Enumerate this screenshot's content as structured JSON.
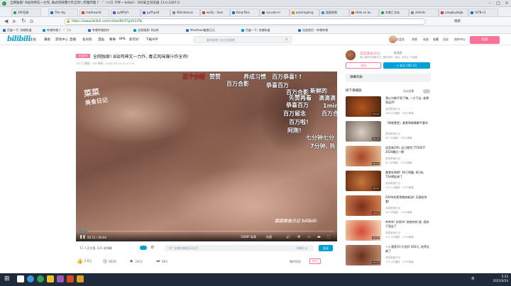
{
  "window": {
    "title": "全网独家! B站鸡神又一力作, 毒式风味爆汁炸全鸡!_哔哩哔哩 (゜-゜)つロ 干杯~-bilibili - 360安全浏览器 13.0.2287.0"
  },
  "tabs": [
    {
      "label": "360导航"
    },
    {
      "label": "The sky"
    },
    {
      "label": "mathworld"
    },
    {
      "label": "pyMPyfs"
    },
    {
      "label": "pyPhyalt"
    },
    {
      "label": "Wikidatavis"
    },
    {
      "label": "wolfy - Sam"
    },
    {
      "label": "Kmq-filos"
    },
    {
      "label": "via plan-Ir"
    },
    {
      "label": "piesimgiong"
    },
    {
      "label": "超星视频"
    },
    {
      "label": "Hide on bu"
    },
    {
      "label": "杂食汇总站"
    },
    {
      "label": "sitekits"
    },
    {
      "label": "yangkujialgb"
    },
    {
      "label": "YoTB+2"
    }
  ],
  "addressbar": {
    "url": "https://www.bilibili.com/video/BV1Tg4113Tw",
    "search_label": "搜索"
  },
  "bookmarks": [
    {
      "label": "百度一下, 你就知道"
    },
    {
      "label": "哔哩哔哩 (゜-゜)つ"
    },
    {
      "label": "哔哩哔哩创作"
    },
    {
      "label": "全网独家! B站鸡"
    },
    {
      "label": "Meetfood美食日记"
    },
    {
      "label": "百度一下, 你就知道"
    },
    {
      "label": "动态首页 - 哔哩哔哩"
    }
  ],
  "site_header": {
    "logo": "bilibili",
    "nav": [
      "主站",
      "番剧",
      "游戏中心",
      "直播",
      "会员购",
      "漫画",
      "赛事",
      "BML",
      "新年好",
      "下载APP"
    ],
    "search_placeholder": "春季美食少女社恩能哦",
    "user_nav": [
      "大会员",
      "消息",
      "动态",
      "收藏",
      "历史",
      "创作中心"
    ],
    "upload_label": "投稿"
  },
  "video": {
    "badge": "全站排行",
    "title": "全网独家! B站鸡神又一力作, 毒式风味爆汁炸全鸡!",
    "meta": "16.7万播放 · 520弹幕 · 2021-03-23 21:47:19",
    "watermark_line1": "菜菜",
    "watermark_line2": "美食日记",
    "bottom_watermark": "菜菜美食日记 bilibili",
    "time": "00:12 / 06:04",
    "quality": "1080P 高清",
    "speed": "倍速",
    "progress_fraction": 0.033
  },
  "danmaku": [
    {
      "text": "三个小时",
      "color": "#ff3333"
    },
    {
      "text": "赞赞",
      "color": "#ffffff"
    },
    {
      "text": "养成习惯",
      "color": "#ffffff"
    },
    {
      "text": "百万恭喜! !",
      "color": "#ffffff"
    },
    {
      "text": "百万合影",
      "color": "#ffffff"
    },
    {
      "text": "恭喜百万",
      "color": "#ffffff"
    },
    {
      "text": "百万合影",
      "color": "#ffffff"
    },
    {
      "text": "新鲜的",
      "color": "#ffffff"
    },
    {
      "text": "先赞再看",
      "color": "#ffffff"
    },
    {
      "text": "滴滴滴",
      "color": "#ffffff"
    },
    {
      "text": "恭喜百万",
      "color": "#ffffff"
    },
    {
      "text": "1min",
      "color": "#ffffff"
    },
    {
      "text": "百万留念",
      "color": "#ffffff"
    },
    {
      "text": "百万合",
      "color": "#ffffff"
    },
    {
      "text": "百万啦!",
      "color": "#ffffff"
    },
    {
      "text": "阿刚!",
      "color": "#ffffff"
    },
    {
      "text": "七分钟七分",
      "color": "#ffffff"
    },
    {
      "text": "7分钟, 热",
      "color": "#ffffff"
    }
  ],
  "danmaku_bar": {
    "viewers": "72 人正在看, 625 条弹幕",
    "input_placeholder": "发个友善的弹幕见证当下",
    "send_label": "发送",
    "etiquette": "弹幕礼仪"
  },
  "actions": [
    {
      "icon": "thumbs-up-icon",
      "label": "2.6万"
    },
    {
      "icon": "coin-icon",
      "label": "8559"
    },
    {
      "icon": "star-icon",
      "label": "2412"
    },
    {
      "icon": "share-icon",
      "label": "493"
    }
  ],
  "actions_right": {
    "report": "稿件投诉",
    "note": "笔记"
  },
  "up": {
    "name": "菜菜美食日记",
    "message": "发消息",
    "desc": "用心做好吃美食日记, 圈叫我你一朋友, 点关注, 不迷路",
    "charge_label": "充电",
    "follow_label": "+ 关注 100.3万"
  },
  "danmaku_list": {
    "label": "弹幕列表"
  },
  "related_header": {
    "label": "接下来播放",
    "autoplay": "自动连播"
  },
  "related": [
    {
      "title": "我以为做不到了嘛, 一刀下去, 谁想到这声!",
      "author": "菜菜美食日记",
      "stats": "168.4万播放 · 3852弹幕",
      "duration": "05:42",
      "color1": "#b3541e",
      "color2": "#5a2a10"
    },
    {
      "title": "「探夜食堂」美食和故事都不要米",
      "author": "菜菜美食日记",
      "stats": "98.3万播放 · 2851弹幕",
      "duration": "06:18",
      "color1": "#d9d0c7",
      "color2": "#7a6a5c"
    },
    {
      "title": "这里来200, 自己做完了55007! 2020最后一期",
      "author": "菜菜美食日记",
      "stats": "61.4万播放 · 1914弹幕",
      "duration": "05:11",
      "color1": "#a94424",
      "color2": "#e0b388"
    },
    {
      "title": "美食吃两吧! 36只鸡腿, 8斤肉, 72H烤起来了",
      "author": "菜菜美食日记",
      "stats": "140.1万播放 · 4739弹幕",
      "duration": "05:09",
      "color1": "#c8763a",
      "color2": "#6a2d12"
    },
    {
      "title": "200块的家常腊肉秘诀! 无限给你看!",
      "author": "菜菜美食日记",
      "stats": "58.9万播放 · 1924弹幕",
      "duration": "04:54",
      "color1": "#7c2e1e",
      "color2": "#d07a4a"
    },
    {
      "title": "哔哔哔! 好家伙! 饱饱的的 屏, 我终于到这了",
      "author": "菜菜美食日记",
      "stats": "101.3万播放 · 4738弹幕",
      "duration": "05:37",
      "color1": "#d44b32",
      "color2": "#f1c9a9"
    },
    {
      "title": "一入我是3斤大龙虾 450元, 吃得太爽了",
      "author": "菜菜美食日记",
      "stats": "172.4万播放 · 4739弹幕",
      "duration": "05:31",
      "color1": "#6d2f1e",
      "color2": "#b9876a"
    }
  ],
  "taskbar": {
    "time": "5:33",
    "date": "2021/6/24",
    "lang": "英"
  }
}
